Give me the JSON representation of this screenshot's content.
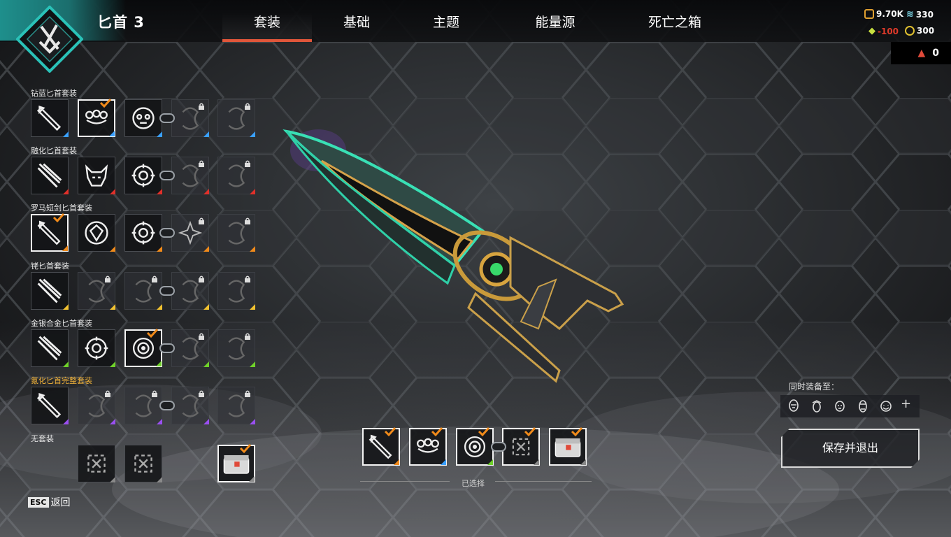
{
  "header": {
    "weapon_name": "匕首 3",
    "tabs": [
      "套装",
      "基础",
      "主题",
      "能量源",
      "死亡之箱"
    ],
    "active_tab": "套装"
  },
  "currency": {
    "legend_tokens": "9.70K",
    "apex_coins": "330",
    "crafting_metals": "-100",
    "heirloom_shards": "300",
    "legend_tokens_icon": "legend-token-icon",
    "apex_coins_icon": "apex-coins-icon",
    "crafting_icon": "crafting-metals-icon",
    "shards_icon": "heirloom-shards-icon"
  },
  "box_counter": {
    "value": "0"
  },
  "sets": [
    {
      "label": "钻蓝匕首套装",
      "tier_color": "#3aa0ff",
      "gold": false
    },
    {
      "label": "融化匕首套装",
      "tier_color": "#e0302a",
      "gold": false
    },
    {
      "label": "罗马短剑匕首套装",
      "tier_color": "#f08a1a",
      "gold": false
    },
    {
      "label": "铑匕首套装",
      "tier_color": "#f2c230",
      "gold": false
    },
    {
      "label": "金银合金匕首套装",
      "tier_color": "#6fd12a",
      "gold": false
    },
    {
      "label": "氪化匕首完整套装",
      "tier_color": "#9a4ff0",
      "gold": true
    },
    {
      "label": "无套装",
      "tier_color": "#8a8a8a",
      "gold": false
    }
  ],
  "selected": {
    "label": "已选择"
  },
  "share": {
    "title": "同时装备至：",
    "plus": "+"
  },
  "buttons": {
    "save_exit": "保存并退出",
    "back": "返回",
    "esc_key": "ESC"
  },
  "colors": {
    "accent": "#e0563a",
    "teal": "#1e8f8c",
    "gold_label": "#f2b33a"
  }
}
